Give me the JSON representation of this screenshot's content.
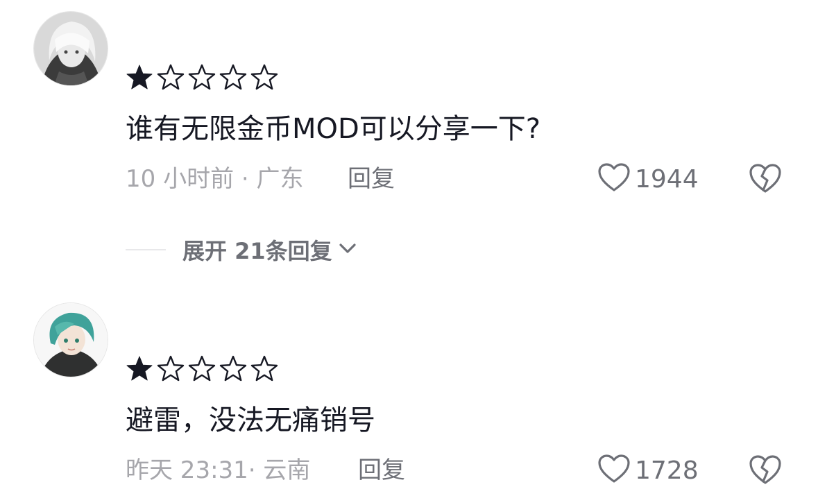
{
  "comments": [
    {
      "rating": 1,
      "rating_max": 5,
      "text": "谁有无限金币MOD可以分享一下?",
      "meta": "10 小时前 · 广东",
      "reply_label": "回复",
      "like_count": "1944",
      "expand_label": "展开 21条回复"
    },
    {
      "rating": 1,
      "rating_max": 5,
      "text": "避雷，没法无痛销号",
      "meta": "昨天 23:31· 云南",
      "reply_label": "回复",
      "like_count": "1728"
    }
  ],
  "icons": {
    "like": "heart-outline-icon",
    "dislike": "broken-heart-icon",
    "expand": "chevron-down-icon"
  },
  "colors": {
    "text": "#161823",
    "meta": "#a6a6ab",
    "action": "#6d6f76"
  }
}
